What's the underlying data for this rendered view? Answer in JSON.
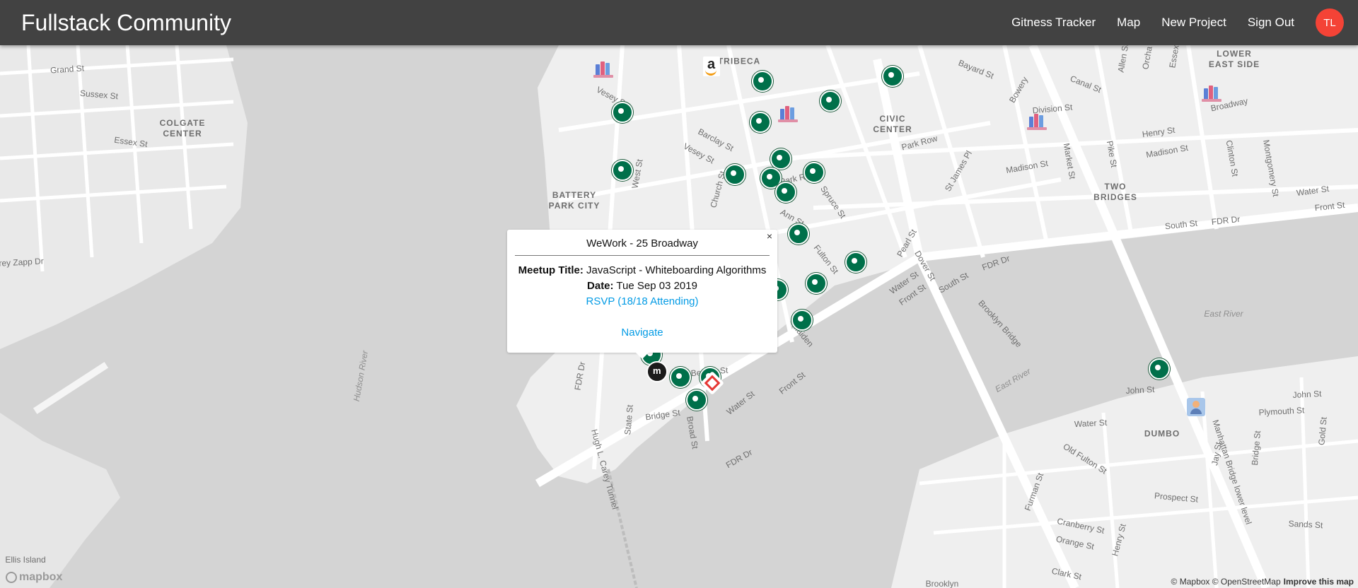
{
  "navbar": {
    "brand": "Fullstack Community",
    "links": [
      "Gitness Tracker",
      "Map",
      "New Project",
      "Sign Out"
    ],
    "avatar_initials": "TL"
  },
  "map": {
    "districts": {
      "colgate_center": "COLGATE\nCENTER",
      "battery_park_city": "BATTERY\nPARK CITY",
      "tribeca": "TRIBECA",
      "civic_center": "CIVIC\nCENTER",
      "lower_east_side": "LOWER\nEAST SIDE",
      "two_bridges": "TWO\nBRIDGES",
      "dumbo": "DUMBO"
    },
    "water": {
      "hudson_river": "Hudson River",
      "east_river_1": "East River",
      "east_river_2": "East River"
    },
    "streets": {
      "grand_st": "Grand St",
      "sussex_st": "Sussex St",
      "essex_st": "Essex St",
      "zapp_dr": "rey Zapp Dr",
      "vesey_st_1": "Vesey St",
      "vesey_st_2": "Vesey St",
      "barclay_st": "Barclay St",
      "church_st": "Church St",
      "west_st": "West St",
      "ann_st": "Ann St",
      "fulton_st": "Fulton St",
      "park_row_1": "Park Row",
      "park_row_2": "Park Row",
      "spruce_st": "Spruce St",
      "bayard_st": "Bayard St",
      "canal_st": "Canal St",
      "bowery": "Bowery",
      "division_st": "Division St",
      "broadway": "Broadway",
      "henry_st": "Henry St",
      "madison_st_1": "Madison St",
      "madison_st_2": "Madison St",
      "market_st": "Market St",
      "pike_st": "Pike St",
      "clinton_st": "Clinton St",
      "montgomery_st": "Montgomery St",
      "water_st_1": "Water St",
      "water_st_2": "Water St",
      "water_st_3": "Water St",
      "front_st_1": "Front St",
      "front_st_2": "Front St",
      "front_st_3": "Front St",
      "south_st_1": "South St",
      "south_st_2": "South St",
      "fdr_dr_1": "FDR Dr",
      "fdr_dr_2": "FDR Dr",
      "fdr_dr_3": "FDR Dr",
      "fdr_dr_4": "FDR Dr",
      "pearl_st": "Pearl St",
      "dover_st": "Dover St",
      "st_james_pl": "St James Pl",
      "brooklyn_bridge": "Brooklyn Bridge",
      "maiden_ln": "Maiden",
      "beaver_st": "Beaver St",
      "bridge_st": "Bridge St",
      "state_st": "State St",
      "broad_st": "Broad St",
      "hugh_carey": "Hugh L. Carey Tunnel",
      "john_st_1": "John St",
      "john_st_2": "John St",
      "plymouth_st": "Plymouth St",
      "old_fulton_st": "Old Fulton St",
      "manhattan_bridge": "Manhattan Bridge lower level",
      "prospect_st": "Prospect St",
      "sands_st": "Sands St",
      "bridge_st_bk": "Bridge St",
      "gold_st": "Gold St",
      "jay_st": "Jay St",
      "furman_st": "Furman St",
      "cranberry_st": "Cranberry St",
      "orange_st": "Orange St",
      "henry_st_bk": "Henry St",
      "clark_st": "Clark St",
      "ellis_island": "Ellis Island",
      "brooklyn": "Brooklyn",
      "allen_st": "Allen St",
      "orchard": "Orcha",
      "essex": "Essex"
    },
    "attribution": "© Mapbox © OpenStreetMap",
    "improve_link": "Improve this map",
    "logo_text": "mapbox"
  },
  "popup": {
    "close": "×",
    "title": "WeWork - 25 Broadway",
    "meetup_label": "Meetup Title:",
    "meetup_value": " JavaScript - Whiteboarding Algorithms",
    "date_label": "Date:",
    "date_value": " Tue Sep 03 2019",
    "rsvp": "RSVP (18/18 Attending)",
    "navigate": "Navigate"
  },
  "colors": {
    "navbar": "#424242",
    "avatar": "#f44336",
    "link": "#039be5",
    "starbucks": "#00704a",
    "land": "#e4e4e4",
    "water": "#d4d4d4"
  }
}
